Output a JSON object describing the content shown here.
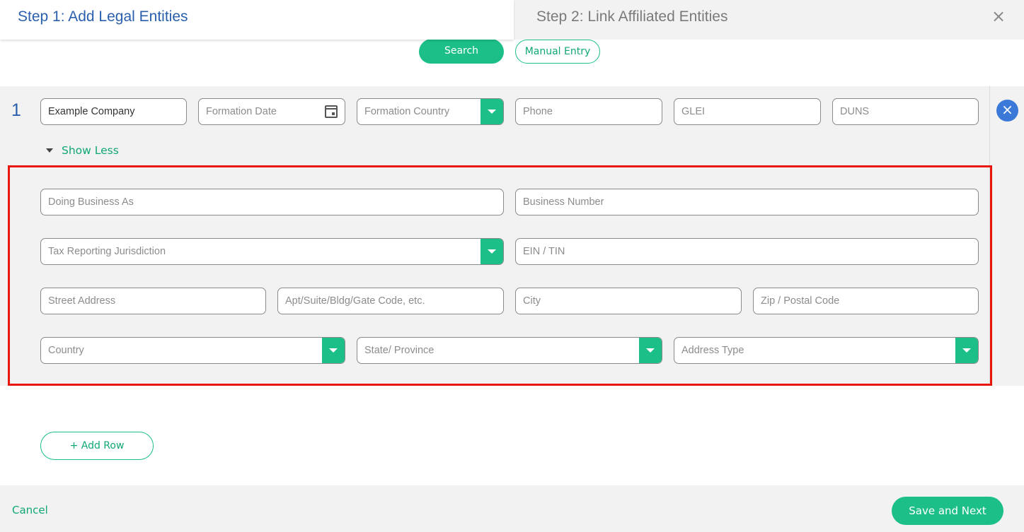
{
  "header": {
    "step1_label": "Step 1:  Add Legal Entities",
    "step2_label": "Step 2:  Link Affiliated Entities",
    "close_icon": "×"
  },
  "actions": {
    "search_label": "Search",
    "manual_entry_label": "Manual Entry"
  },
  "row": {
    "number": "1",
    "remove_icon": "×",
    "company_name_value": "Example Company",
    "formation_date_placeholder": "Formation Date",
    "formation_country_placeholder": "Formation Country",
    "phone_placeholder": "Phone",
    "glei_placeholder": "GLEI",
    "duns_placeholder": "DUNS",
    "show_less_label": "Show Less"
  },
  "details": {
    "doing_business_as_placeholder": "Doing Business As",
    "business_number_placeholder": "Business Number",
    "tax_jurisdiction_placeholder": "Tax Reporting Jurisdiction",
    "ein_tin_placeholder": "EIN / TIN",
    "street_placeholder": "Street Address",
    "apt_placeholder": "Apt/Suite/Bldg/Gate Code, etc.",
    "city_placeholder": "City",
    "zip_placeholder": "Zip / Postal Code",
    "country_placeholder": "Country",
    "state_placeholder": "State/ Province",
    "address_type_placeholder": "Address Type"
  },
  "footer": {
    "add_row_label": "+ Add Row",
    "cancel_label": "Cancel",
    "save_next_label": "Save and Next"
  },
  "colors": {
    "accent_green": "#1bbf87",
    "title_blue": "#2a5fad",
    "highlight_red": "#e8160b"
  }
}
